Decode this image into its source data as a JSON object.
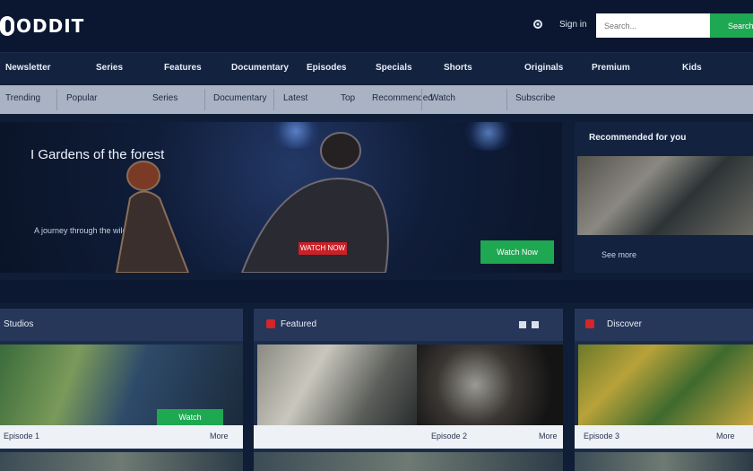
{
  "header": {
    "logo_text": "ODDIT",
    "nav_link": "Sign in",
    "search_placeholder": "Search...",
    "search_button": "Search"
  },
  "main_nav": [
    "Newsletter",
    "Series",
    "Features",
    "Documentary",
    "Episodes",
    "Specials",
    "Shorts",
    "Originals",
    "Premium",
    "Kids"
  ],
  "sub_nav": [
    "Trending",
    "Popular",
    "Series",
    "Documentary",
    "Latest",
    "Top",
    "Recommended",
    "Watch",
    "Subscribe"
  ],
  "hero": {
    "title": "I Gardens of the forest",
    "subtitle": "A journey through the wild lands",
    "tag": "WATCH NOW",
    "cta": "Watch Now"
  },
  "promo": {
    "title": "Recommended for you",
    "subtitle": "See more"
  },
  "cards": [
    {
      "title": "Studios",
      "button": "Watch",
      "foot_left": "Episode 1",
      "foot_right": "More"
    },
    {
      "title": "Featured",
      "button": "",
      "foot_left": "Episode 2",
      "foot_right": "More"
    },
    {
      "title": "Discover",
      "button": "",
      "foot_left": "Episode 3",
      "foot_right": "More"
    }
  ],
  "colors": {
    "background": "#0f1d36",
    "header": "#0b1730",
    "accent_green": "#1ea852",
    "accent_red": "#c92128",
    "sub_nav": "#a9b3c3"
  },
  "icons": [
    "settings-icon",
    "user-icon"
  ]
}
